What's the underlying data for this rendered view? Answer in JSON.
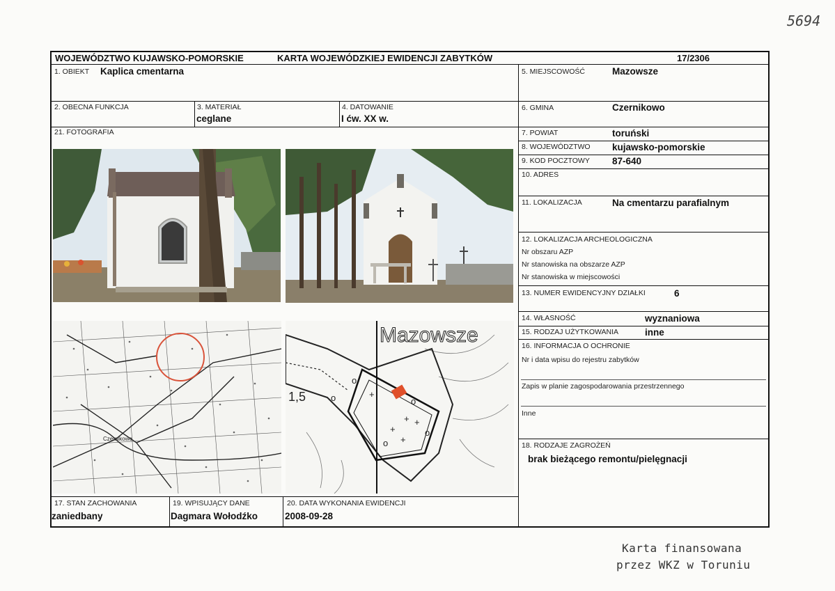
{
  "page_number_hand": "5694",
  "header": {
    "region": "WOJEWÓDZTWO KUJAWSKO-POMORSKIE",
    "title": "KARTA WOJEWÓDZKIEJ EWIDENCJI ZABYTKÓW",
    "number": "17/2306"
  },
  "fields": {
    "obiekt": {
      "label": "1. OBIEKT",
      "value": "Kaplica cmentarna"
    },
    "funkcja": {
      "label": "2. OBECNA FUNKCJA",
      "value": ""
    },
    "material": {
      "label": "3. MATERIAŁ",
      "value": "ceglane"
    },
    "datowanie": {
      "label": "4. DATOWANIE",
      "value": "I ćw. XX w."
    },
    "fotografia": {
      "label": "21. FOTOGRAFIA"
    },
    "miejscowosc": {
      "label": "5. MIEJSCOWOŚĆ",
      "value": "Mazowsze"
    },
    "gmina": {
      "label": "6. GMINA",
      "value": "Czernikowo"
    },
    "powiat": {
      "label": "7. POWIAT",
      "value": "toruński"
    },
    "wojewodztwo": {
      "label": "8. WOJEWÓDZTWO",
      "value": "kujawsko-pomorskie"
    },
    "kod": {
      "label": "9. KOD POCZTOWY",
      "value": "87-640"
    },
    "adres": {
      "label": "10. ADRES",
      "value": ""
    },
    "lokalizacja": {
      "label": "11. LOKALIZACJA",
      "value": "Na cmentarzu parafialnym"
    },
    "archeo": {
      "label": "12. LOKALIZACJA ARCHEOLOGICZNA",
      "line1": "Nr obszaru AZP",
      "line2": "Nr stanowiska na obszarze AZP",
      "line3": "Nr stanowiska w miejscowości"
    },
    "dzialka": {
      "label": "13. NUMER EWIDENCYJNY DZIAŁKI",
      "value": "6"
    },
    "wlasnosc": {
      "label": "14. WŁASNOŚĆ",
      "value": "wyznaniowa"
    },
    "uzytkowanie": {
      "label": "15. RODZAJ UŻYTKOWANIA",
      "value": "inne"
    },
    "ochrona": {
      "label": "16. INFORMACJA O OCHRONIE",
      "line1": "Nr i data wpisu do rejestru zabytków",
      "line2": "Zapis w planie zagospodarowania przestrzennego",
      "line3": "Inne"
    },
    "zagrozenia": {
      "label": "18. RODZAJE ZAGROŻEŃ",
      "value": "brak bieżącego remontu/pielęgnacji"
    },
    "stan": {
      "label": "17. STAN ZACHOWANIA",
      "value": "zaniedbany"
    },
    "wpisujacy": {
      "label": "19. WPISUJĄCY DANE",
      "value": "Dagmara Wołodźko"
    },
    "data": {
      "label": "20. DATA WYKONANIA EWIDENCJI",
      "value": "2008-09-28"
    }
  },
  "map_labels": {
    "village": "Mazowsze",
    "contour": "1,5",
    "town": "Czernikowo"
  },
  "stamp": {
    "line1": "Karta finansowana",
    "line2": "przez WKZ w Toruniu"
  },
  "colors": {
    "marker": "#e0502a",
    "circle": "#d9533a"
  }
}
